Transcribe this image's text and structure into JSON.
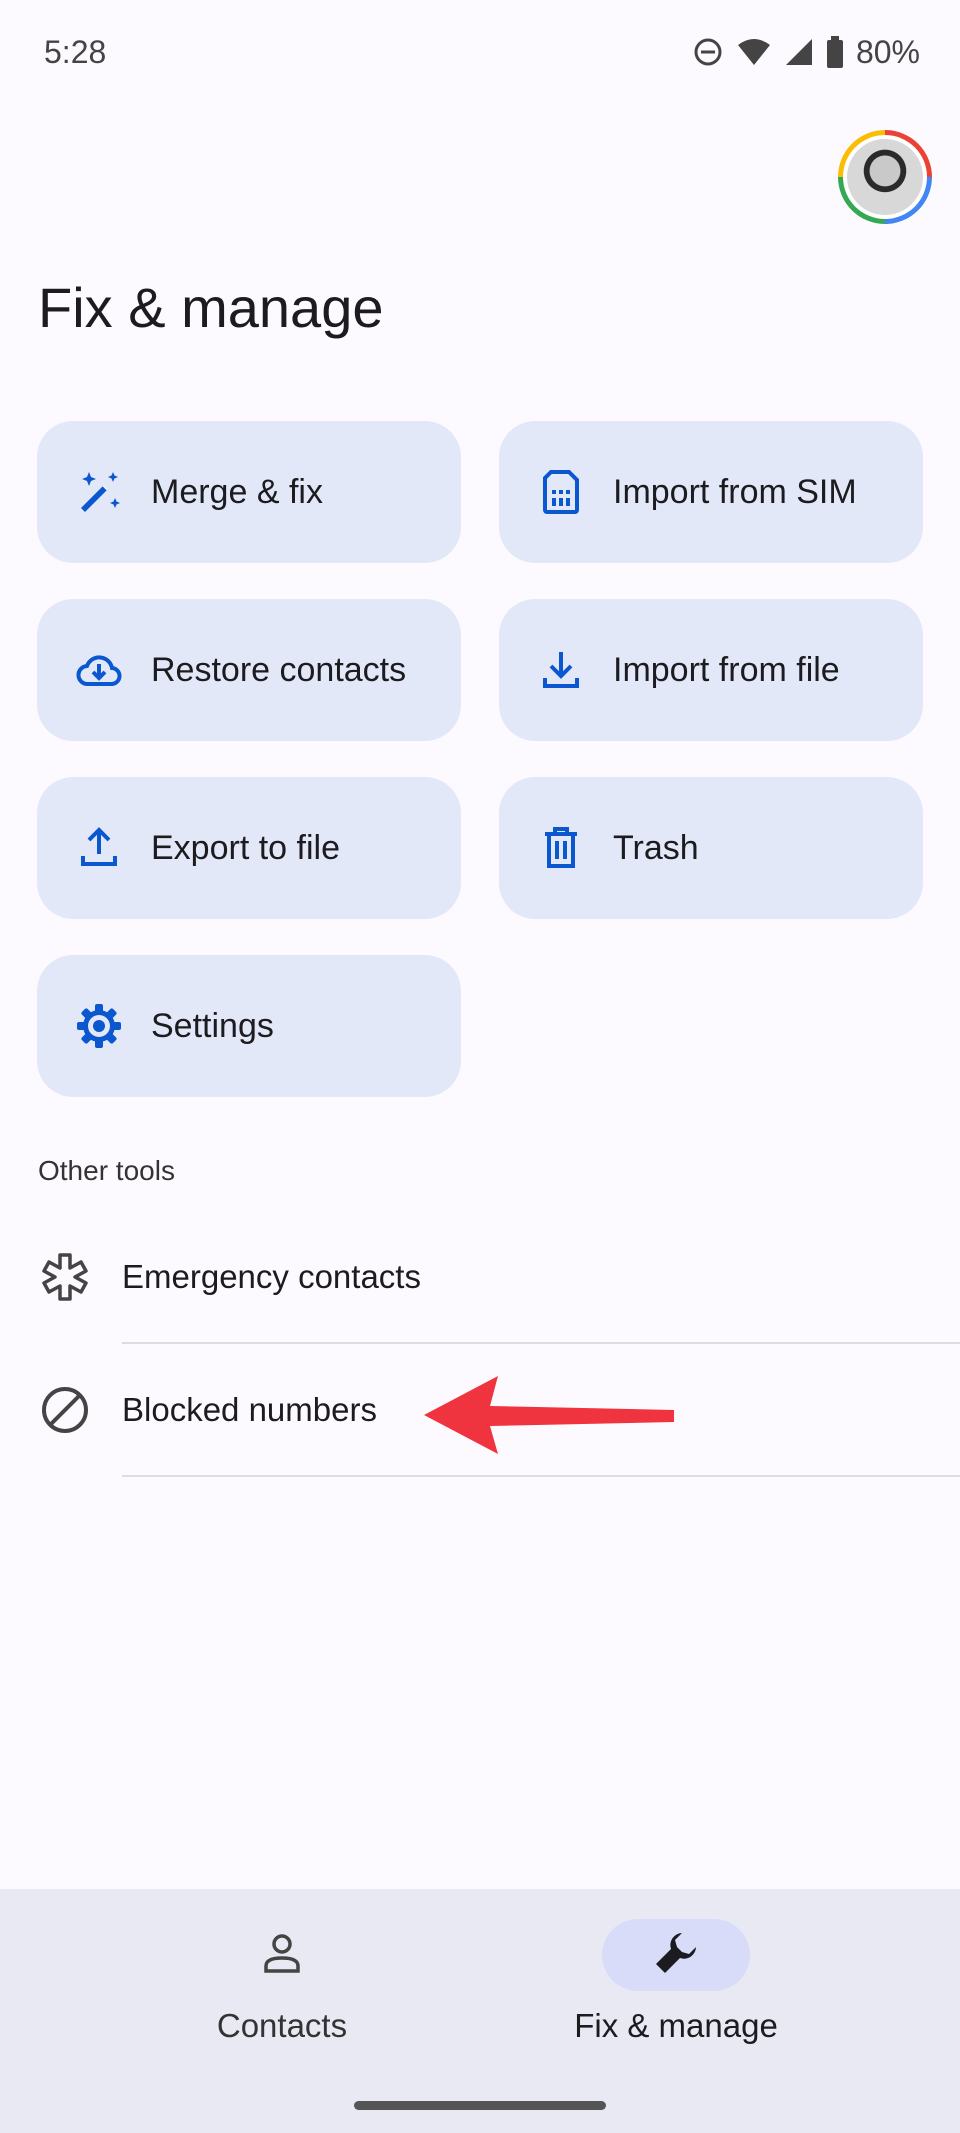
{
  "status_bar": {
    "time": "5:28",
    "battery": "80%",
    "icons": [
      "do-not-disturb-icon",
      "wifi-icon",
      "cell-signal-icon",
      "battery-icon"
    ]
  },
  "header": {
    "title": "Fix & manage",
    "avatar": "account-avatar"
  },
  "tiles": [
    {
      "label": "Merge & fix",
      "icon": "magic-wand-icon"
    },
    {
      "label": "Import from SIM",
      "icon": "sim-card-icon"
    },
    {
      "label": "Restore contacts",
      "icon": "cloud-download-icon"
    },
    {
      "label": "Import from file",
      "icon": "download-icon"
    },
    {
      "label": "Export to file",
      "icon": "upload-icon"
    },
    {
      "label": "Trash",
      "icon": "trash-icon"
    },
    {
      "label": "Settings",
      "icon": "gear-icon"
    }
  ],
  "other_tools": {
    "heading": "Other tools",
    "items": [
      {
        "label": "Emergency contacts",
        "icon": "medical-asterisk-icon"
      },
      {
        "label": "Blocked numbers",
        "icon": "block-icon"
      }
    ]
  },
  "bottom_nav": {
    "items": [
      {
        "label": "Contacts",
        "icon": "person-icon",
        "active": false
      },
      {
        "label": "Fix & manage",
        "icon": "wrench-icon",
        "active": true
      }
    ]
  },
  "colors": {
    "tile_bg": "#e3e8f8",
    "icon_blue": "#0b57d0",
    "annotation_arrow": "#f0343f",
    "nav_bg": "#e9e9f4",
    "nav_active_pill": "#d8dcf8"
  }
}
